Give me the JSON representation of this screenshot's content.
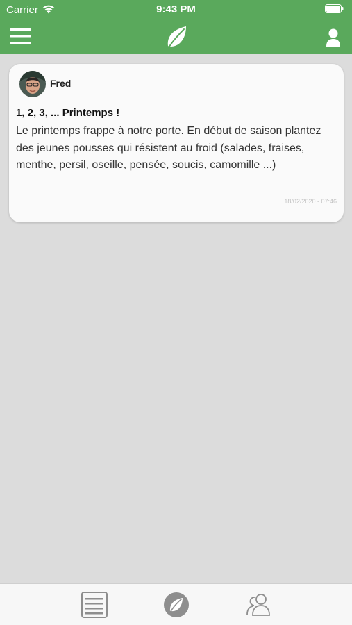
{
  "status": {
    "carrier": "Carrier",
    "time": "9:43 PM"
  },
  "colors": {
    "brand_green": "#5aa95c",
    "tab_icon": "#8e8e8e"
  },
  "icons": {
    "menu": "hamburger-menu-icon",
    "logo": "leaf-icon",
    "profile": "user-icon",
    "tab_list": "list-document-icon",
    "tab_feed": "leaf-circle-icon",
    "tab_users": "users-icon"
  },
  "post": {
    "author": "Fred",
    "title": "1, 2, 3, ... Printemps !",
    "body": "Le printemps frappe à notre porte. En début de saison plantez des jeunes pousses qui résistent au froid (salades, fraises, menthe, persil, oseille, pensée, soucis, camomille ...)",
    "date": "18/02/2020 - 07:46"
  }
}
